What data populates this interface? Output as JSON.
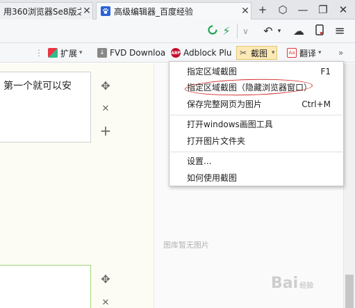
{
  "tabs": [
    {
      "label": "用360浏览器Se8版之",
      "close": "✕"
    },
    {
      "label": "高级编辑器_百度经验",
      "close": "✕"
    }
  ],
  "window": {
    "new_tab": "+",
    "skin": "⬡",
    "minimize": "—",
    "restore": "❐",
    "close": "✕"
  },
  "nav": {
    "speed": "⚡",
    "undo": "↶",
    "cloud": "☁",
    "phone": "▯",
    "menu": "≡"
  },
  "extensions": [
    {
      "label": "扩展",
      "caret": "▾"
    },
    {
      "label": "FVD Downloa"
    },
    {
      "label": "Adblock Plu",
      "icon_text": "ABP"
    },
    {
      "label": "截图",
      "caret": "▾"
    },
    {
      "label": "翻译",
      "caret": "▾",
      "icon_text": "Aa"
    },
    {
      "label": "»"
    }
  ],
  "editor": {
    "card_text": "第一个就可以安",
    "move_icon": "✥",
    "delete_icon": "✕",
    "add_icon": "+",
    "no_images": "图库暂无图片"
  },
  "menu": {
    "items": [
      {
        "label": "指定区域截图",
        "shortcut": "F1"
      },
      {
        "label": "指定区域截图（隐藏浏览器窗口）",
        "shortcut": ""
      },
      {
        "label": "保存完整网页为图片",
        "shortcut": "Ctrl+M"
      },
      {
        "label": "打开windows画图工具",
        "shortcut": ""
      },
      {
        "label": "打开图片文件夹",
        "shortcut": ""
      },
      {
        "label": "设置...",
        "shortcut": ""
      },
      {
        "label": "如何使用截图",
        "shortcut": ""
      }
    ]
  },
  "watermark": {
    "text": "Bai",
    "sub": "经验"
  },
  "colors": {
    "accent": "#d42a2a",
    "tab_bg": "#e4e6ea",
    "editor_bg": "#fdfcf4",
    "card2_border": "#9ed27a"
  }
}
